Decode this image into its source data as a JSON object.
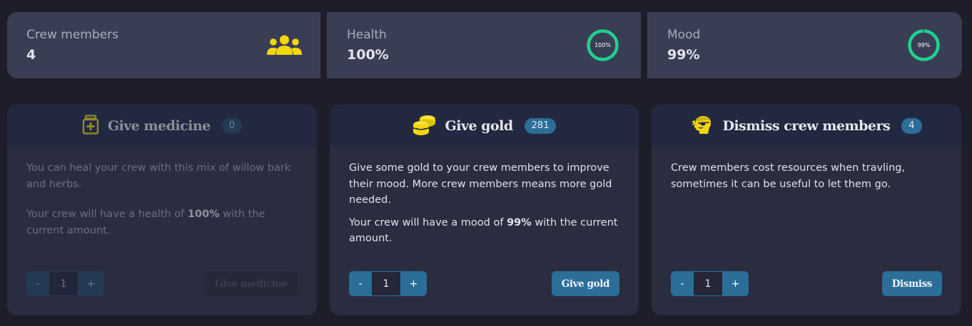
{
  "stats": [
    {
      "label": "Crew members",
      "value": "4",
      "icon": "crew-icon"
    },
    {
      "label": "Health",
      "value": "100%",
      "ring_text": "100%",
      "ring_fraction": 1.0
    },
    {
      "label": "Mood",
      "value": "99%",
      "ring_text": "99%",
      "ring_fraction": 0.99
    }
  ],
  "colors": {
    "accent": "#2b6e98",
    "ring": "#1fd18f",
    "icon_yellow": "#f2d70e"
  },
  "cards": {
    "medicine": {
      "title": "Give medicine",
      "badge": "0",
      "text1": "You can heal your crew with this mix of willow bark and herbs.",
      "text2_pre": "Your crew will have a health of ",
      "text2_bold": "100%",
      "text2_post": " with the current amount.",
      "stepper_minus": "-",
      "stepper_value": "1",
      "stepper_plus": "+",
      "action": "Give medicine",
      "icon": "medicine-icon"
    },
    "gold": {
      "title": "Give gold",
      "badge": "281",
      "text1": "Give some gold to your crew members to improve their mood. More crew members means more gold needed.",
      "text2_pre": "Your crew will have a mood of ",
      "text2_bold": "99%",
      "text2_post": " with the current amount.",
      "stepper_minus": "-",
      "stepper_value": "1",
      "stepper_plus": "+",
      "action": "Give gold",
      "icon": "gold-coins-icon"
    },
    "dismiss": {
      "title": "Dismiss crew members",
      "badge": "4",
      "text1": "Crew members cost resources when travling, sometimes it can be useful to let them go.",
      "stepper_minus": "-",
      "stepper_value": "1",
      "stepper_plus": "+",
      "action": "Dismiss",
      "icon": "pirate-head-icon"
    }
  }
}
